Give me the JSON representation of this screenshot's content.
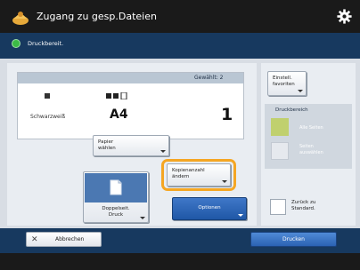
{
  "window": {
    "title": "Zugang zu gesp.Dateien"
  },
  "status": {
    "text": "Druckbereit."
  },
  "settings": {
    "selected_label": "Gewählt: 2",
    "color_mode": "Schwarzweiß",
    "paper_size": "A4",
    "copies": "1"
  },
  "buttons": {
    "papier_waehlen": "Papier\nwählen",
    "kopienanzahl_aendern": "Kopienanzahl\nändern",
    "doppelseit_druck": "Doppelseit.\nDruck",
    "optionen": "Optionen",
    "einstell_favoriten": "Einstell.\nfavoriten",
    "abbrechen": "Abbrechen",
    "drucken": "Drucken"
  },
  "side": {
    "druckbereich_label": "Druckbereich",
    "alle_seiten": "Alle Seiten",
    "seiten_auswaehlen": "Seiten\nauswählen",
    "zurueck_label": "Zurück zu\nStandard."
  },
  "colors": {
    "title_bar": "#1a1a1a",
    "status_bar": "#17395f",
    "accent_blue": "#2b62b3",
    "highlight": "#f5a623",
    "status_ok": "#3cba46"
  }
}
